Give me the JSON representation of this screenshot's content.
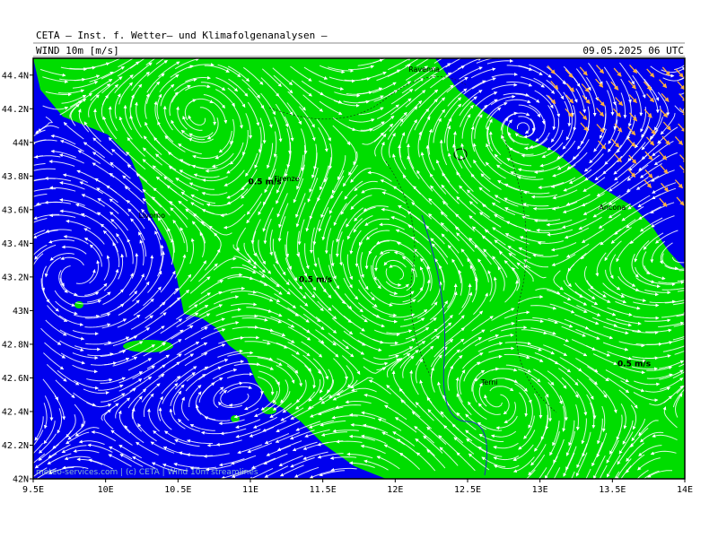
{
  "header": {
    "institute": "CETA – Inst. f. Wetter– und Klimafolgenanalysen –",
    "variable": "WIND 10m [m/s]",
    "datetime": "09.05.2025 06 UTC"
  },
  "map": {
    "lon_range": [
      9.5,
      14.0
    ],
    "lat_range": [
      42.0,
      44.5
    ],
    "x_ticks": [
      "9.5E",
      "10E",
      "10.5E",
      "11E",
      "11.5E",
      "12E",
      "12.5E",
      "13E",
      "13.5E",
      "14E"
    ],
    "y_ticks": [
      "44.4N",
      "44.2N",
      "44N",
      "43.8N",
      "43.6N",
      "43.4N",
      "43.2N",
      "43N",
      "42.8N",
      "42.6N",
      "42.4N",
      "42.2N",
      "42N"
    ],
    "colors": {
      "land_wind": "#00dd00",
      "sea_wind": "#0000ee",
      "streamline": "#ffffff",
      "strong_wind_arrows": "#ffb040"
    },
    "cities": [
      {
        "name": "Ravenna",
        "lon": 12.2,
        "lat": 44.42
      },
      {
        "name": "Firenze",
        "lon": 11.25,
        "lat": 43.77
      },
      {
        "name": "Livorno",
        "lon": 10.32,
        "lat": 43.55
      },
      {
        "name": "Ancona",
        "lon": 13.5,
        "lat": 43.6
      },
      {
        "name": "Terni",
        "lon": 12.65,
        "lat": 42.56
      }
    ],
    "speed_labels": [
      {
        "text": "0.5 m/s",
        "lon": 11.1,
        "lat": 43.75
      },
      {
        "text": "0.5 m/s",
        "lon": 11.45,
        "lat": 43.17
      },
      {
        "text": "0.5 m/s",
        "lon": 13.65,
        "lat": 42.67
      }
    ],
    "watermark": "meteo-services.com | (c) CETA | Wind 10m streamlines"
  }
}
